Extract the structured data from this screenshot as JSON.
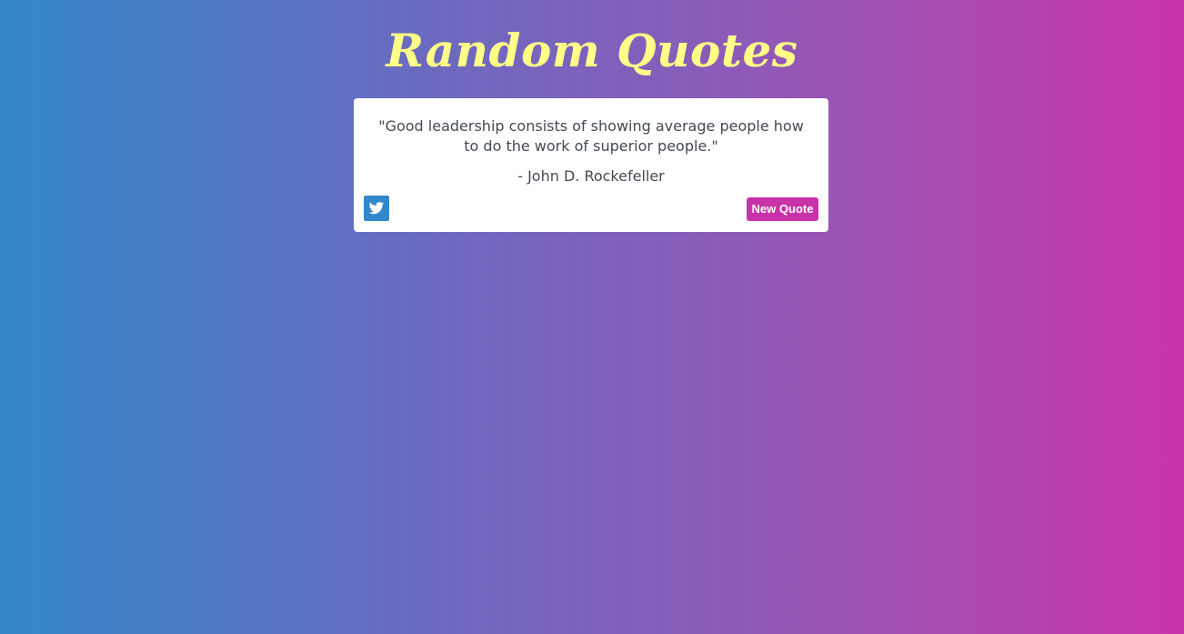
{
  "header": {
    "title": "Random Quotes"
  },
  "quote": {
    "text": "\"Good leadership consists of showing average people how to do the work of superior people.\"",
    "author": "- John D. Rockefeller"
  },
  "actions": {
    "tweet_icon": "twitter-icon",
    "new_quote_label": "New Quote"
  },
  "colors": {
    "title": "#ffff88",
    "accent_pink": "#c933a8",
    "accent_blue": "#3388cc",
    "text": "#444a52",
    "card_background": "#ffffff"
  }
}
